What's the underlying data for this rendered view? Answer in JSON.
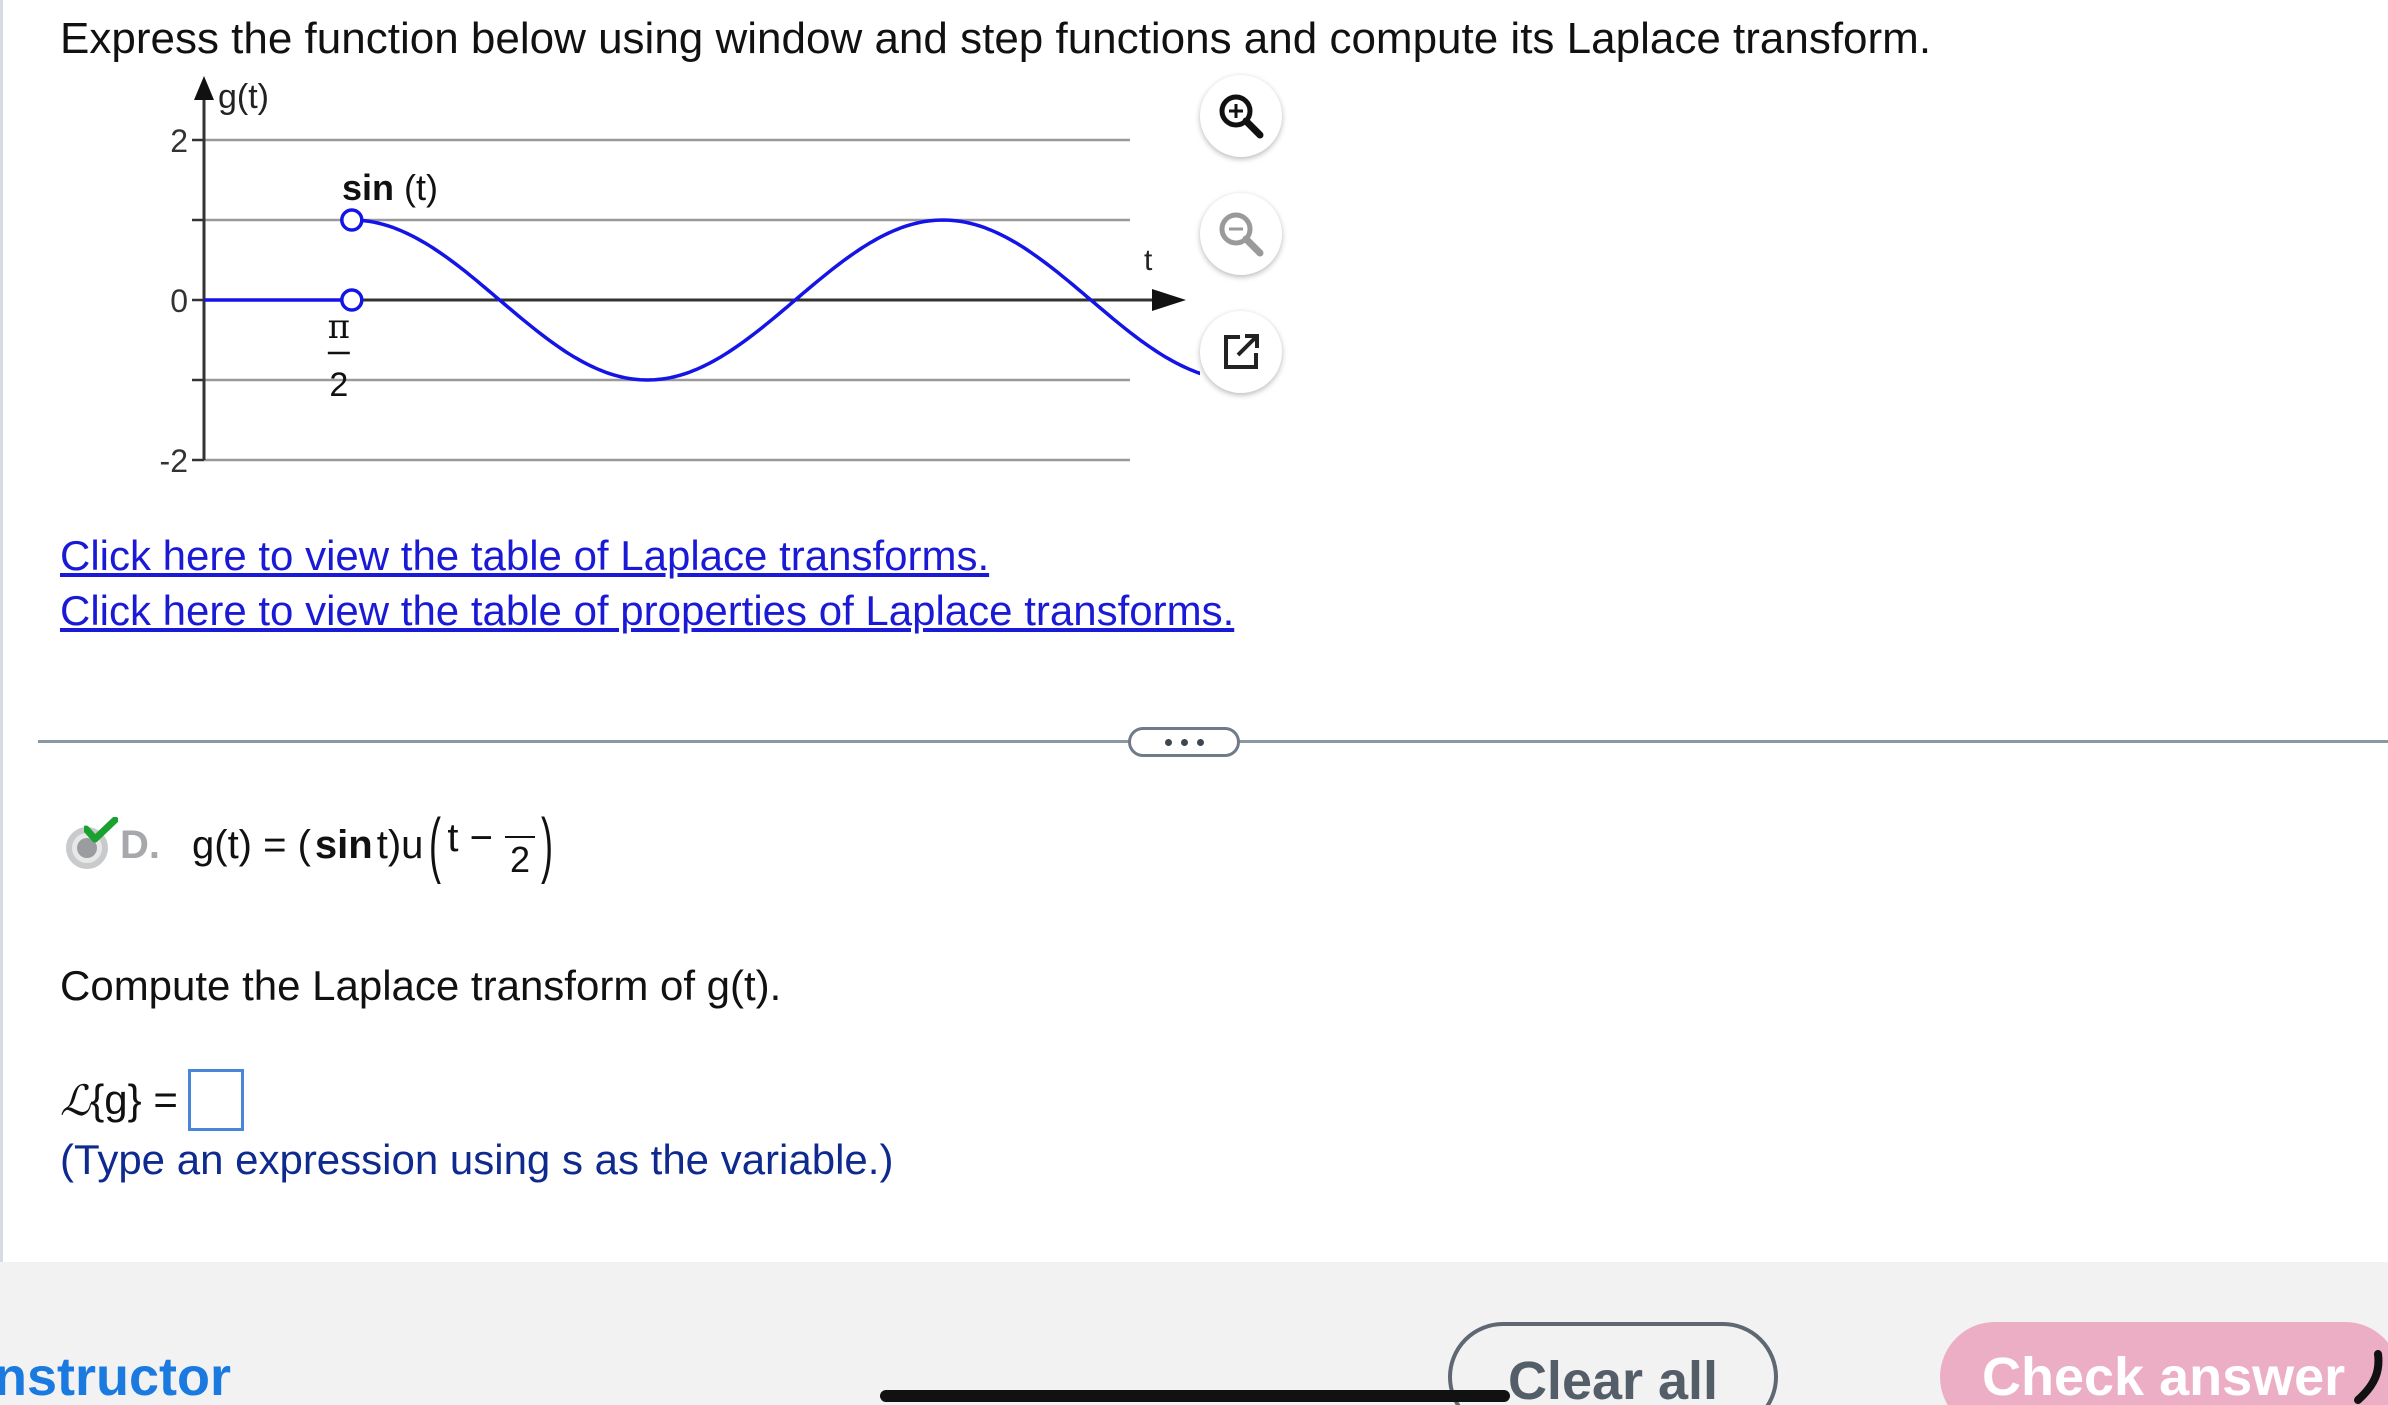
{
  "question": {
    "text": "Express the function below using window and step functions and compute its Laplace transform."
  },
  "graph": {
    "y_axis_label": "g(t)",
    "x_axis_label": "t",
    "y_ticks": [
      "2",
      "0",
      "-2"
    ],
    "x_tick": {
      "numerator": "π",
      "denominator": "2"
    },
    "curve_label_bold": "sin",
    "curve_label_rest": " (t)",
    "colors": {
      "curve": "#1414e6",
      "axis": "#333333",
      "grid": "#9a9a9a"
    }
  },
  "chart_data": {
    "type": "line",
    "title": "",
    "xlabel": "t",
    "ylabel": "g(t)",
    "ylim": [
      -2,
      2
    ],
    "x_ticks": [
      "π/2"
    ],
    "y_ticks": [
      2,
      0,
      -2
    ],
    "grid": true,
    "series": [
      {
        "name": "sin (t)",
        "x": [
          0,
          0.7854,
          1.5708,
          2.3562,
          3.1416,
          3.927,
          4.7124,
          5.4978,
          6.2832,
          7.0686,
          7.854,
          8.6394,
          9.4248,
          10.2102,
          10.9956
        ],
        "y": [
          0,
          0,
          1,
          0.7071,
          0,
          -0.7071,
          -1,
          -0.7071,
          0,
          0.7071,
          1,
          0.7071,
          0,
          -0.7071,
          -1
        ]
      }
    ],
    "annotations": [
      "sin (t)"
    ],
    "open_points": [
      [
        1.5708,
        0
      ],
      [
        1.5708,
        1
      ]
    ]
  },
  "tools": {
    "zoom_in_icon": "zoom-in-icon",
    "zoom_out_icon": "zoom-out-icon",
    "popout_icon": "external-link-icon"
  },
  "links": {
    "laplace_table": "Click here to view the table of Laplace transforms.",
    "properties_table": "Click here to view the table of properties of Laplace transforms."
  },
  "choice": {
    "letter": "D.",
    "lhs": "g(t) = (",
    "sin": "sin",
    "mid": " t)u",
    "arg": "t −",
    "frac_numerator": "",
    "frac_denominator": "2"
  },
  "prompt": "Compute the Laplace transform of g(t).",
  "answer": {
    "lhs_script": "ℒ",
    "lhs_rest": "{g} =",
    "value": ""
  },
  "hint": "(Type an expression using s as the variable.)",
  "footer": {
    "instructor": "nstructor",
    "clear_all": "Clear all",
    "check_answer": "Check answer"
  }
}
